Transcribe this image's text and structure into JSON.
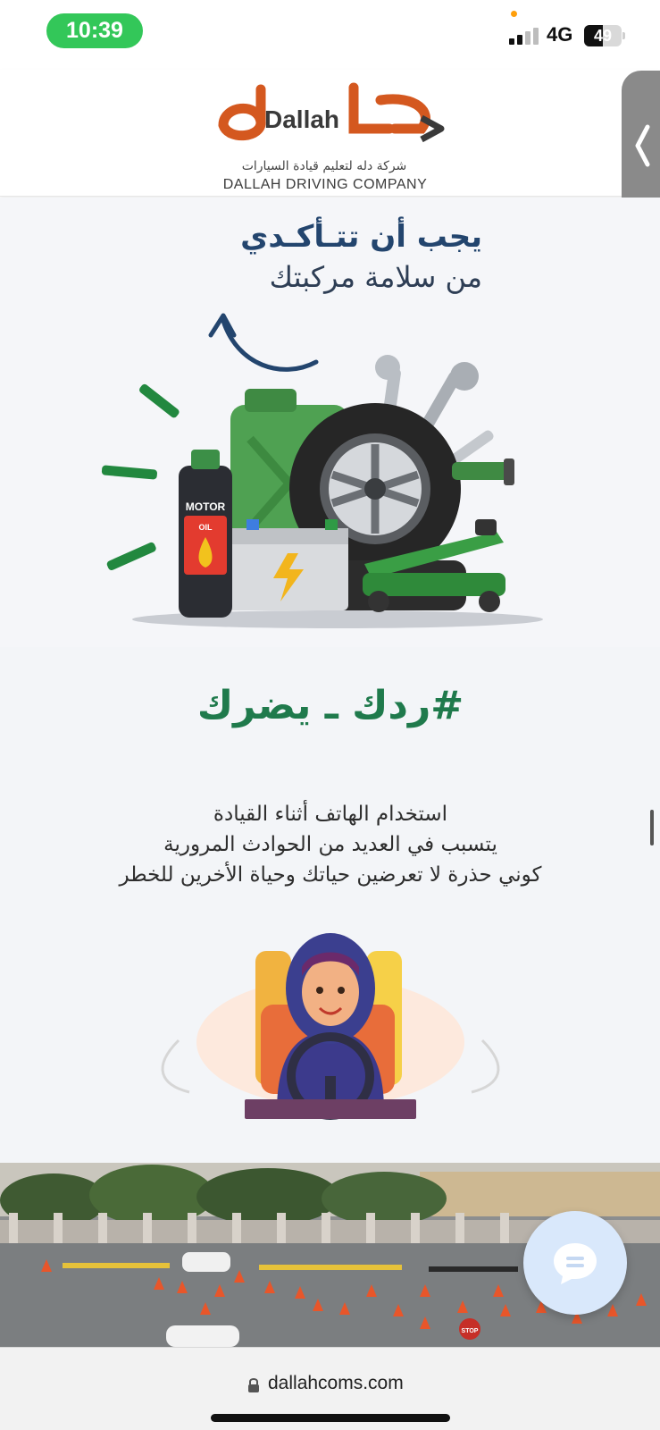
{
  "status_bar": {
    "time": "10:39",
    "network": "4G",
    "battery_level": "49",
    "battery_fraction": 0.49,
    "signal_bars_filled": 2,
    "signal_bars_total": 4,
    "time_pill_color": "#33c759"
  },
  "header": {
    "logo_wordmark": "Dallah",
    "logo_arabic_tagline": "شركة دله لتعليم قيادة السيارات",
    "logo_english": "DALLAH DRIVING COMPANY",
    "brand_orange": "#d4581f",
    "side_tab_icon": "chevron-left-icon"
  },
  "safety_banner": {
    "headline_line1": "يجب أن تتـأكـدي",
    "headline_line2": "من سلامة مركبتك",
    "headline_color": "#23456e",
    "battery_label": "MOTOR",
    "oil_label": "OIL"
  },
  "phone_banner": {
    "hashtag": "#ردك ـ يضرك",
    "hashtag_color": "#1f7a4c",
    "lines": [
      "استخدام الهاتف أثناء القيادة",
      "يتسبب في العديد من الحوادث المرورية",
      "كوني حذرة لا تعرضين حياتك وحياة الأخرين للخطر"
    ]
  },
  "photo": {
    "stop_sign_text": "STOP"
  },
  "chat_button": {
    "icon": "chat-bubble-icon"
  },
  "url_bar": {
    "url": "dallahcoms.com",
    "icon": "lock-icon"
  }
}
